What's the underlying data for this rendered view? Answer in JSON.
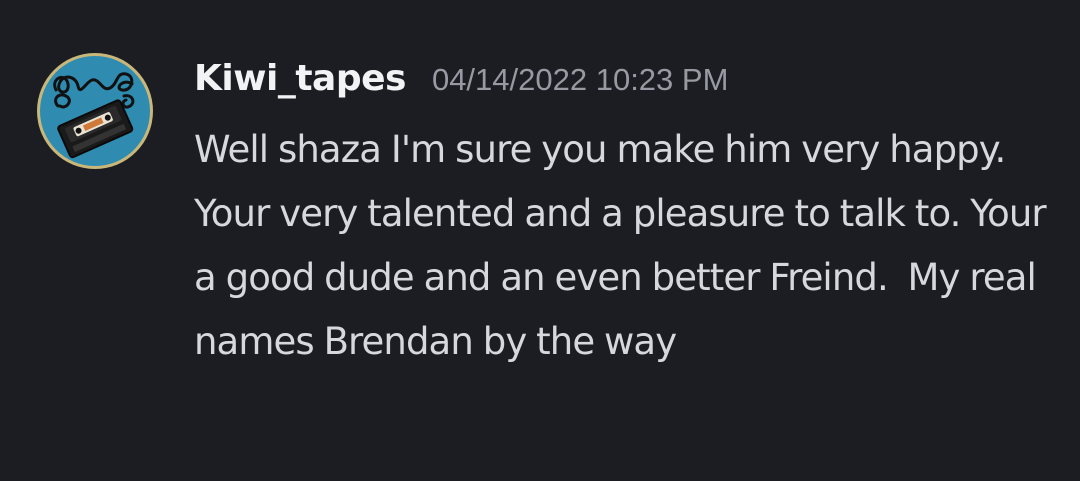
{
  "message": {
    "author": "Kiwi_tapes",
    "timestamp": "04/14/2022 10:23 PM",
    "text": "Well shaza I'm sure you make him very happy. Your very talented and a pleasure to talk to. Your a good dude and an even better Freind.  My real names Brendan by the way",
    "avatar_icon": "vhs-cassette-icon"
  },
  "colors": {
    "background": "#1c1d22",
    "username": "#f2f3f5",
    "timestamp": "#979aa3",
    "text": "#d6d8dd",
    "avatar_bg": "#2f8bb0",
    "avatar_ring": "#c9b77a"
  }
}
